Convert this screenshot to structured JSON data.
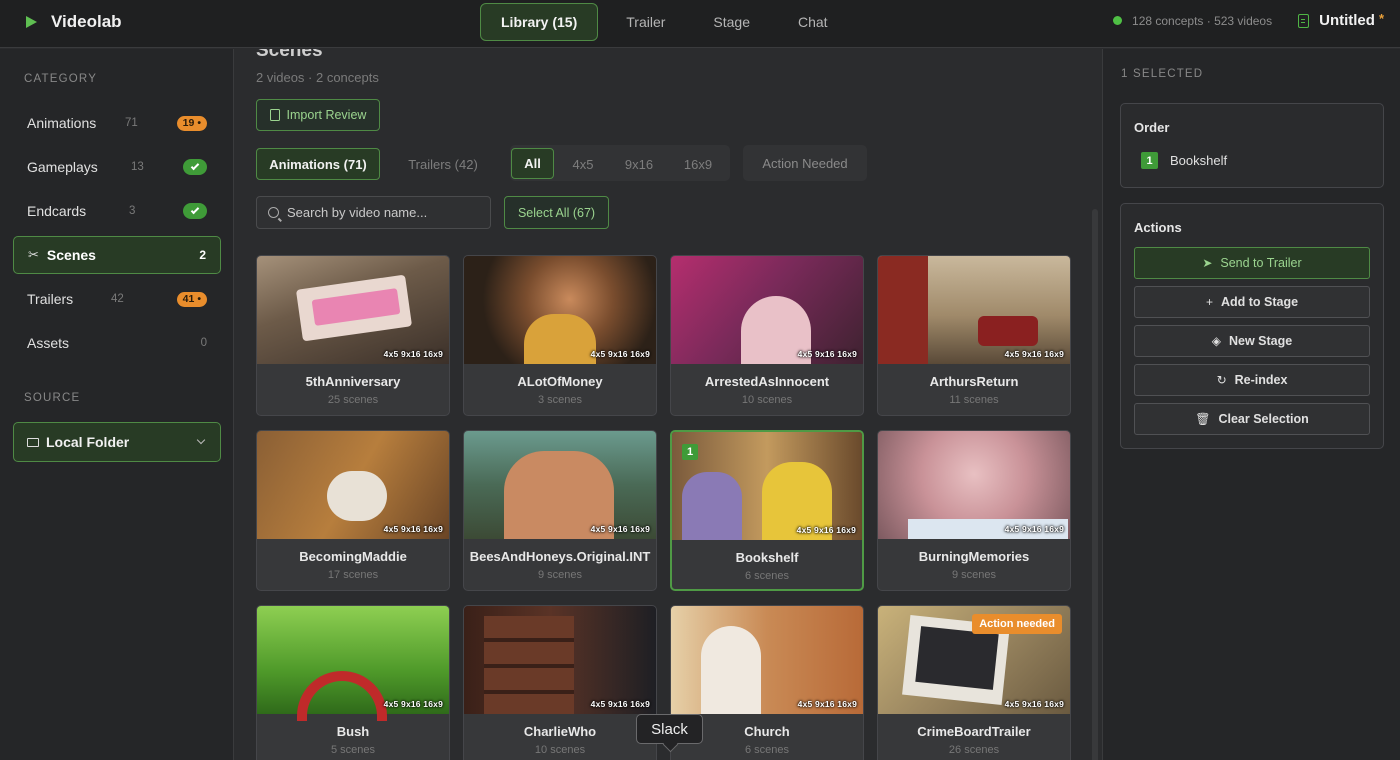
{
  "app": {
    "name": "Videolab"
  },
  "nav": {
    "tabs": [
      "Library (15)",
      "Trailer",
      "Stage",
      "Chat"
    ],
    "active_tab": 0
  },
  "status": {
    "stats": "128 concepts · 523 videos",
    "project_name": "Untitled",
    "unsaved_marker": "*"
  },
  "sidebar": {
    "category_label": "CATEGORY",
    "items": [
      {
        "label": "Animations",
        "count": "71",
        "badge": "19"
      },
      {
        "label": "Gameplays",
        "count": "13",
        "badge": "check"
      },
      {
        "label": "Endcards",
        "count": "3",
        "badge": "check"
      },
      {
        "label": "Scenes",
        "count": "2",
        "active": true
      },
      {
        "label": "Trailers",
        "count": "42",
        "badge": "41"
      },
      {
        "label": "Assets",
        "count": "0"
      }
    ],
    "source_label": "SOURCE",
    "source_value": "Local Folder"
  },
  "main": {
    "title": "Scenes",
    "subtitle": "2 videos · 2 concepts",
    "import_button": "Import Review",
    "type_tabs": [
      "Animations (71)",
      "Trailers (42)"
    ],
    "aspect_tabs": [
      "All",
      "4x5",
      "9x16",
      "16x9"
    ],
    "action_needed_tab": "Action Needed",
    "search_placeholder": "Search by video name...",
    "select_all_button": "Select All (67)",
    "aspect_overlay": "4x5 9x16 16x9",
    "cards": [
      {
        "name": "5thAnniversary",
        "scenes": "25 scenes"
      },
      {
        "name": "ALotOfMoney",
        "scenes": "3 scenes"
      },
      {
        "name": "ArrestedAsInnocent",
        "scenes": "10 scenes"
      },
      {
        "name": "ArthursReturn",
        "scenes": "11 scenes"
      },
      {
        "name": "BecomingMaddie",
        "scenes": "17 scenes"
      },
      {
        "name": "BeesAndHoneys.Original.INT",
        "scenes": "9 scenes"
      },
      {
        "name": "Bookshelf",
        "scenes": "6 scenes",
        "selected_order": "1"
      },
      {
        "name": "BurningMemories",
        "scenes": "9 scenes"
      },
      {
        "name": "Bush",
        "scenes": "5 scenes"
      },
      {
        "name": "CharlieWho",
        "scenes": "10 scenes"
      },
      {
        "name": "Church",
        "scenes": "6 scenes"
      },
      {
        "name": "CrimeBoardTrailer",
        "scenes": "26 scenes",
        "badge": "Action needed"
      }
    ],
    "tooltip": "Slack"
  },
  "right_panel": {
    "selected_label": "1 SELECTED",
    "order_title": "Order",
    "order_items": [
      {
        "num": "1",
        "name": "Bookshelf"
      }
    ],
    "actions_title": "Actions",
    "actions": [
      "Send to Trailer",
      "Add to Stage",
      "New Stage",
      "Re-index",
      "Clear Selection"
    ]
  },
  "colors": {
    "accent": "#4f9a45",
    "accent_bg": "#283b25",
    "warning": "#e98d2c"
  }
}
